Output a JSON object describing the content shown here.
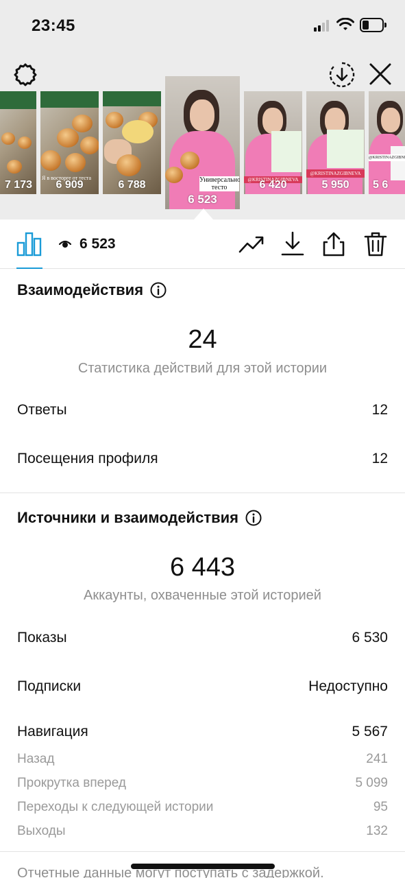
{
  "status_bar": {
    "time": "23:45"
  },
  "thumbnails": [
    {
      "views": "7 173",
      "kind": "food"
    },
    {
      "views": "6 909",
      "kind": "food",
      "overlay": "Я в восторге от теста"
    },
    {
      "views": "6 788",
      "kind": "food"
    },
    {
      "views": "6 523",
      "kind": "person",
      "caption": "Универсальное тесто",
      "selected": true
    },
    {
      "views": "6 420",
      "kind": "person",
      "caption": "@KRISTINAZGIBNEVA"
    },
    {
      "views": "5 950",
      "kind": "person",
      "caption": "@KRISTINAZGIBNEVA"
    },
    {
      "views": "5 6",
      "kind": "person",
      "caption": "@KRISTINAZGIBNEVA"
    }
  ],
  "toolbar": {
    "views": "6 523"
  },
  "interactions": {
    "title": "Взаимодействия",
    "total": "24",
    "caption": "Статистика действий для этой истории",
    "rows": [
      {
        "label": "Ответы",
        "value": "12"
      },
      {
        "label": "Посещения профиля",
        "value": "12"
      }
    ]
  },
  "discovery": {
    "title": "Источники и взаимодействия",
    "total": "6 443",
    "caption": "Аккаунты, охваченные этой историей",
    "rows": [
      {
        "label": "Показы",
        "value": "6 530"
      },
      {
        "label": "Подписки",
        "value": "Недоступно"
      },
      {
        "label": "Навигация",
        "value": "5 567"
      }
    ],
    "navigation": [
      {
        "label": "Назад",
        "value": "241"
      },
      {
        "label": "Прокрутка вперед",
        "value": "5 099"
      },
      {
        "label": "Переходы к следующей истории",
        "value": "95"
      },
      {
        "label": "Выходы",
        "value": "132"
      }
    ]
  },
  "footer": {
    "note": "Отчетные данные могут поступать с задержкой."
  },
  "colors": {
    "accent": "#1a9bd7",
    "muted": "#8e8e8e",
    "shirt": "#f07cb6"
  },
  "icons": [
    "gear-icon",
    "download-circle-icon",
    "close-icon",
    "bar-chart-icon",
    "eye-icon",
    "trending-icon",
    "download-icon",
    "share-icon",
    "trash-icon",
    "info-icon"
  ]
}
